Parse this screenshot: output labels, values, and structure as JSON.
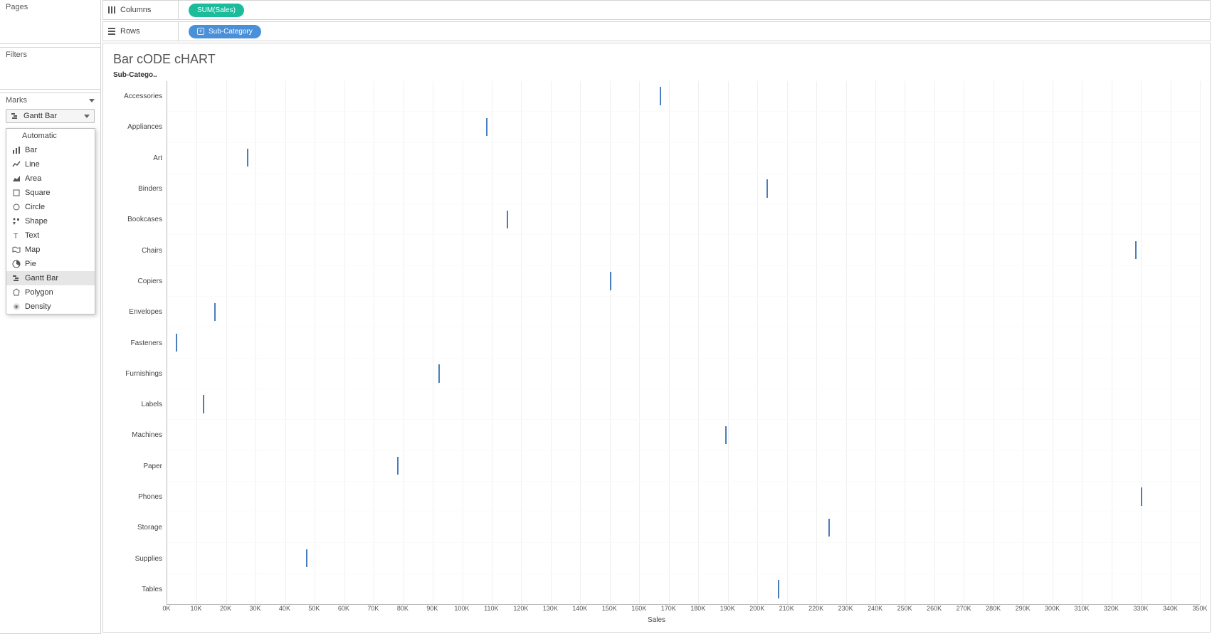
{
  "side": {
    "pages_label": "Pages",
    "filters_label": "Filters",
    "marks_label": "Marks",
    "mark_type_selected": "Gantt Bar",
    "mark_type_options": [
      {
        "key": "auto",
        "label": "Automatic"
      },
      {
        "key": "bar",
        "label": "Bar"
      },
      {
        "key": "line",
        "label": "Line"
      },
      {
        "key": "area",
        "label": "Area"
      },
      {
        "key": "square",
        "label": "Square"
      },
      {
        "key": "circle",
        "label": "Circle"
      },
      {
        "key": "shape",
        "label": "Shape"
      },
      {
        "key": "text",
        "label": "Text"
      },
      {
        "key": "map",
        "label": "Map"
      },
      {
        "key": "pie",
        "label": "Pie"
      },
      {
        "key": "gantt",
        "label": "Gantt Bar"
      },
      {
        "key": "polygon",
        "label": "Polygon"
      },
      {
        "key": "density",
        "label": "Density"
      }
    ]
  },
  "shelves": {
    "columns_label": "Columns",
    "rows_label": "Rows",
    "columns_pill": "SUM(Sales)",
    "rows_pill": "Sub-Category"
  },
  "viz": {
    "title": "Bar cODE cHART",
    "cat_header": "Sub-Catego..",
    "x_axis_title": "Sales"
  },
  "chart_data": {
    "type": "scatter",
    "title": "Bar cODE cHART",
    "xlabel": "Sales",
    "ylabel": "Sub-Category",
    "xlim": [
      0,
      350000
    ],
    "x_ticks": [
      "0K",
      "10K",
      "20K",
      "30K",
      "40K",
      "50K",
      "60K",
      "70K",
      "80K",
      "90K",
      "100K",
      "110K",
      "120K",
      "130K",
      "140K",
      "150K",
      "160K",
      "170K",
      "180K",
      "190K",
      "200K",
      "210K",
      "220K",
      "230K",
      "240K",
      "250K",
      "260K",
      "270K",
      "280K",
      "290K",
      "300K",
      "310K",
      "320K",
      "330K",
      "340K",
      "350K"
    ],
    "categories": [
      "Accessories",
      "Appliances",
      "Art",
      "Binders",
      "Bookcases",
      "Chairs",
      "Copiers",
      "Envelopes",
      "Fasteners",
      "Furnishings",
      "Labels",
      "Machines",
      "Paper",
      "Phones",
      "Storage",
      "Supplies",
      "Tables"
    ],
    "values": [
      167000,
      108000,
      27000,
      203000,
      115000,
      328000,
      150000,
      16000,
      3000,
      92000,
      12000,
      189000,
      78000,
      330000,
      224000,
      47000,
      207000
    ]
  }
}
